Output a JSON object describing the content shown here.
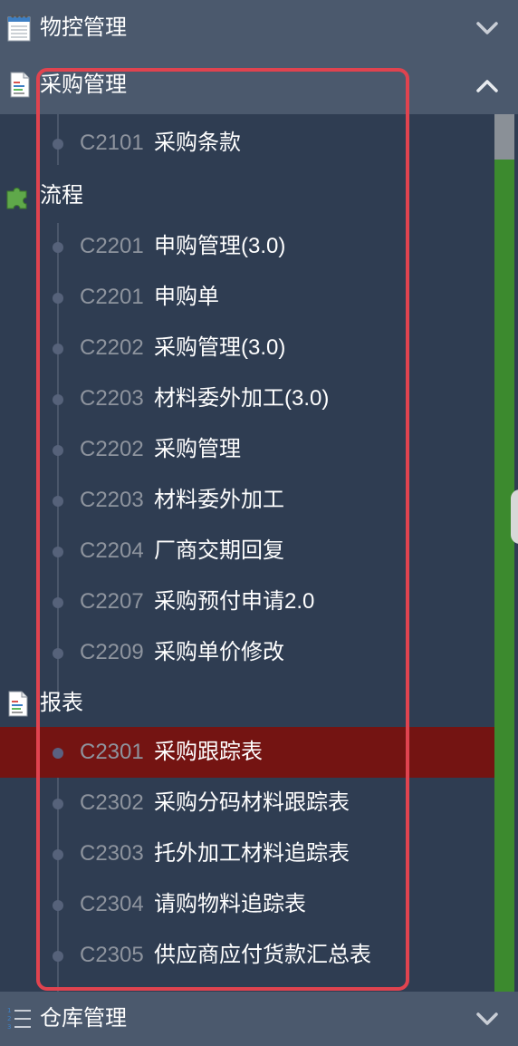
{
  "headers": {
    "wuk": "物控管理",
    "purchase": "采购管理",
    "warehouse": "仓库管理"
  },
  "sections": [
    {
      "title": "流程"
    },
    {
      "title": "报表"
    }
  ],
  "items": [
    {
      "code": "C2101",
      "label": "采购条款"
    },
    {
      "code": "C2201",
      "label": "申购管理(3.0)"
    },
    {
      "code": "C2201",
      "label": "申购单"
    },
    {
      "code": "C2202",
      "label": "采购管理(3.0)"
    },
    {
      "code": "C2203",
      "label": "材料委外加工(3.0)"
    },
    {
      "code": "C2202",
      "label": "采购管理"
    },
    {
      "code": "C2203",
      "label": "材料委外加工"
    },
    {
      "code": "C2204",
      "label": "厂商交期回复"
    },
    {
      "code": "C2207",
      "label": "采购预付申请2.0"
    },
    {
      "code": "C2209",
      "label": "采购单价修改"
    },
    {
      "code": "C2301",
      "label": "采购跟踪表"
    },
    {
      "code": "C2302",
      "label": "采购分码材料跟踪表"
    },
    {
      "code": "C2303",
      "label": "托外加工材料追踪表"
    },
    {
      "code": "C2304",
      "label": "请购物料追踪表"
    },
    {
      "code": "C2305",
      "label": "供应商应付货款汇总表"
    }
  ],
  "active_item": "C2301 采购跟踪表",
  "colors": {
    "header_bg": "#4b596d",
    "menu_bg": "#2f3d52",
    "active_bg": "#741412",
    "code_text": "#8e949e",
    "highlight_border": "#e0434f",
    "scroll_accent": "#3c8a2e"
  },
  "icons": {
    "wuk": "notepad-icon",
    "purchase": "document-icon",
    "flow": "puzzle-icon",
    "report": "document-icon",
    "warehouse": "numbered-list-icon",
    "collapsed": "chevron-down-icon",
    "expanded": "chevron-up-icon"
  }
}
